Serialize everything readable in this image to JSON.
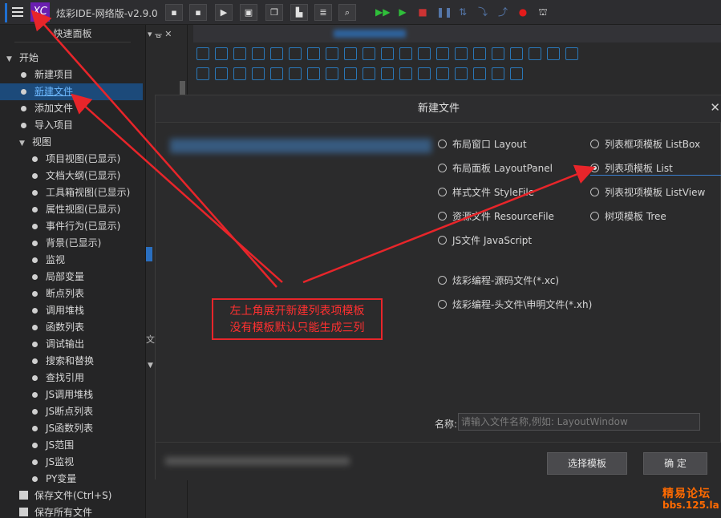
{
  "app": {
    "title": "炫彩IDE-网络版-v2.9.0",
    "logo_text": "XC",
    "accent": "#1f6fd1",
    "logo_color": "#6a1fb0"
  },
  "toolbar": {
    "icons": [
      "save-icon",
      "save-all-icon",
      "run-icon",
      "window-icon",
      "copy-icon",
      "paste-icon",
      "list-icon",
      "search-icon",
      "run-green-icon",
      "step-icon",
      "stop-icon",
      "pause-icon",
      "step-over-icon",
      "step-into-icon",
      "step-out-icon",
      "record-icon",
      "build-icon"
    ]
  },
  "left_panel": {
    "title": "快速面板",
    "items": [
      {
        "label": "开始",
        "kind": "group"
      },
      {
        "label": "新建项目",
        "kind": "leaf"
      },
      {
        "label": "新建文件",
        "kind": "leaf",
        "selected": true
      },
      {
        "label": "添加文件",
        "kind": "leaf"
      },
      {
        "label": "导入项目",
        "kind": "leaf"
      },
      {
        "label": "视图",
        "kind": "subgroup"
      },
      {
        "label": "项目视图(已显示)",
        "kind": "sub"
      },
      {
        "label": "文档大纲(已显示)",
        "kind": "sub"
      },
      {
        "label": "工具箱视图(已显示)",
        "kind": "sub"
      },
      {
        "label": "属性视图(已显示)",
        "kind": "sub"
      },
      {
        "label": "事件行为(已显示)",
        "kind": "sub"
      },
      {
        "label": "背景(已显示)",
        "kind": "sub"
      },
      {
        "label": "监视",
        "kind": "sub"
      },
      {
        "label": "局部变量",
        "kind": "sub"
      },
      {
        "label": "断点列表",
        "kind": "sub"
      },
      {
        "label": "调用堆栈",
        "kind": "sub"
      },
      {
        "label": "函数列表",
        "kind": "sub"
      },
      {
        "label": "调试输出",
        "kind": "sub"
      },
      {
        "label": "搜索和替换",
        "kind": "sub"
      },
      {
        "label": "查找引用",
        "kind": "sub"
      },
      {
        "label": "JS调用堆栈",
        "kind": "sub"
      },
      {
        "label": "JS断点列表",
        "kind": "sub"
      },
      {
        "label": "JS函数列表",
        "kind": "sub"
      },
      {
        "label": "JS范围",
        "kind": "sub"
      },
      {
        "label": "JS监视",
        "kind": "sub"
      },
      {
        "label": "PY变量",
        "kind": "sub"
      },
      {
        "label": "保存文件(Ctrl+S)",
        "kind": "action"
      },
      {
        "label": "保存所有文件",
        "kind": "action"
      }
    ]
  },
  "mid_strip": {
    "header_icons": "▾ ᚗ ✕",
    "fragment_text": "文"
  },
  "dialog": {
    "title": "新建文件",
    "close": "✕",
    "left_options": [
      {
        "label": "布局窗口 Layout"
      },
      {
        "label": "布局面板 LayoutPanel"
      },
      {
        "label": "样式文件 StyleFile"
      },
      {
        "label": "资源文件 ResourceFile"
      },
      {
        "label": "JS文件 JavaScript"
      },
      {
        "label": "炫彩编程-源码文件(*.xc)"
      },
      {
        "label": "炫彩编程-头文件\\申明文件(*.xh)"
      }
    ],
    "right_options": [
      {
        "label": "列表框项模板 ListBox"
      },
      {
        "label": "列表项模板 List",
        "checked": true
      },
      {
        "label": "列表视项模板 ListView"
      },
      {
        "label": "树项模板 Tree"
      }
    ],
    "name_label": "名称:",
    "name_placeholder": "请输入文件名称,例如: LayoutWindow",
    "select_template_button": "选择模板",
    "ok_button": "确 定"
  },
  "annotation": {
    "line1": "左上角展开新建列表项模板",
    "line2": "没有模板默认只能生成三列",
    "color": "#e8252a"
  },
  "watermark": {
    "name": "精易论坛",
    "url": "bbs.125.la"
  }
}
